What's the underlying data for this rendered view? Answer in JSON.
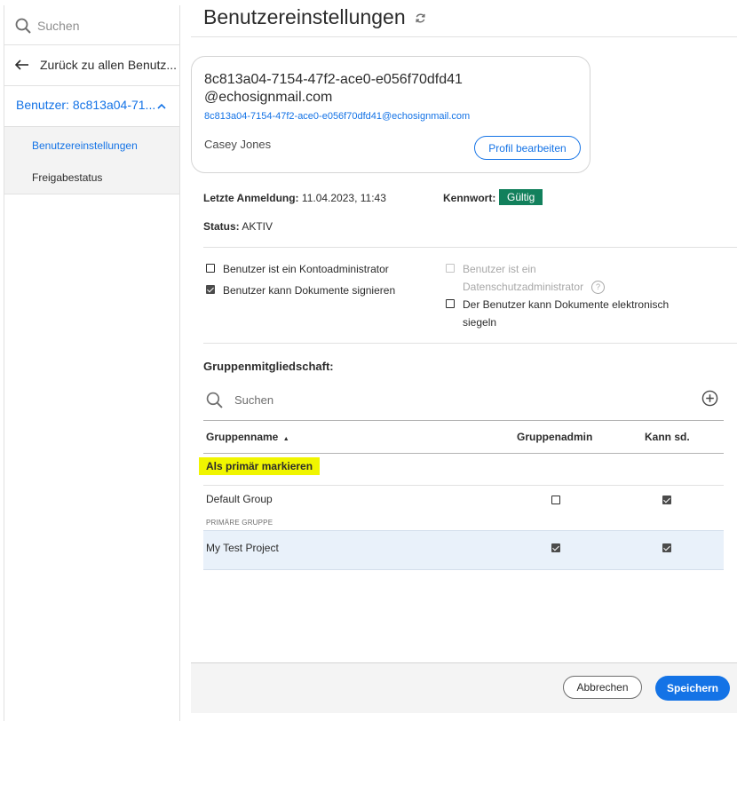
{
  "sidebar": {
    "search_placeholder": "Suchen",
    "back_label": "Zurück zu allen Benutz...",
    "user_label": "Benutzer: 8c813a04-71...",
    "items": [
      {
        "label": "Benutzereinstellungen",
        "active": true
      },
      {
        "label": "Freigabestatus",
        "active": false
      }
    ]
  },
  "header": {
    "title": "Benutzereinstellungen"
  },
  "profile": {
    "user_id": "8c813a04-7154-47f2-ace0-e056f70dfd41 @echosignmail.com",
    "email": "8c813a04-7154-47f2-ace0-e056f70dfd41@echosignmail.com",
    "name": "Casey Jones",
    "edit_button": "Profil bearbeiten"
  },
  "details": {
    "last_login_label": "Letzte Anmeldung:",
    "last_login_value": "11.04.2023, 11:43",
    "password_label": "Kennwort:",
    "password_value": "Gültig",
    "status_label": "Status:",
    "status_value": "AKTIV"
  },
  "permissions": {
    "account_admin": {
      "label": "Benutzer ist ein Kontoadministrator",
      "checked": false
    },
    "can_sign": {
      "label": "Benutzer kann Dokumente signieren",
      "checked": true
    },
    "privacy_admin_line1": "Benutzer ist ein",
    "privacy_admin_line2": "Datenschutzadministrator",
    "privacy_admin_disabled": true,
    "e_seal_line1": "Der Benutzer kann Dokumente elektronisch",
    "e_seal_line2": "siegeln",
    "help_glyph": "?"
  },
  "groups": {
    "heading": "Gruppenmitgliedschaft:",
    "search_placeholder": "Suchen",
    "columns": {
      "name": "Gruppenname",
      "admin": "Gruppenadmin",
      "can_send": "Kann sd."
    },
    "mark_primary_label": "Als primär markieren",
    "primary_tag": "PRIMÄRE GRUPPE",
    "rows": [
      {
        "name": "Default Group",
        "admin": false,
        "can_send": true
      },
      {
        "name": "My Test Project",
        "admin": true,
        "can_send": true
      }
    ]
  },
  "footer": {
    "cancel": "Abbrechen",
    "save": "Speichern"
  },
  "colors": {
    "accent": "#1473e6",
    "valid_badge": "#12805c",
    "highlight": "#f0f500"
  }
}
